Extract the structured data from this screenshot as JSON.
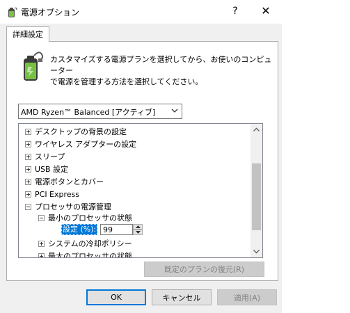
{
  "window": {
    "title": "電源オプション",
    "help_glyph": "?",
    "close_glyph": "✕"
  },
  "tab": {
    "label": "詳細設定"
  },
  "description": "カスタマイズする電源プランを選択してから、お使いのコンピューター\nで電源を管理する方法を選択してください。",
  "plan_select": {
    "value": "AMD Ryzen™ Balanced [アクティブ]"
  },
  "tree": {
    "items": [
      {
        "label": "デスクトップの背景の設定",
        "state": "collapsed"
      },
      {
        "label": "ワイヤレス アダプターの設定",
        "state": "collapsed"
      },
      {
        "label": "スリープ",
        "state": "collapsed"
      },
      {
        "label": "USB 設定",
        "state": "collapsed"
      },
      {
        "label": "電源ボタンとカバー",
        "state": "collapsed"
      },
      {
        "label": "PCI Express",
        "state": "collapsed"
      },
      {
        "label": "プロセッサの電源管理",
        "state": "expanded"
      },
      {
        "label": "最小のプロセッサの状態",
        "state": "expanded"
      },
      {
        "label": "システムの冷却ポリシー",
        "state": "collapsed"
      },
      {
        "label": "最大のプロセッサの状態",
        "state": "collapsed"
      }
    ],
    "setting": {
      "label": "設定 (%):",
      "value": "99"
    }
  },
  "buttons": {
    "restore_defaults": "既定のプランの復元(R)",
    "ok": "OK",
    "cancel": "キャンセル",
    "apply": "適用(A)"
  },
  "colors": {
    "selection": "#0078d7",
    "dialog_bg": "#f0f0f0",
    "disabled_text": "#838383"
  },
  "icons": {
    "app": "power-options-battery-icon",
    "header": "battery-plug-icon"
  }
}
